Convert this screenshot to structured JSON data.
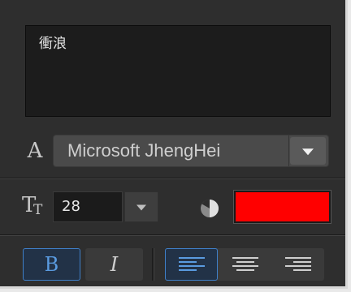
{
  "text_box": {
    "content": "衝浪"
  },
  "font": {
    "icon": "font-A-icon",
    "selected": "Microsoft JhengHei"
  },
  "size": {
    "icon": "font-size-icon",
    "value": "28"
  },
  "color": {
    "icon": "opacity-icon",
    "value": "#ff0000"
  },
  "formatting": {
    "bold_label": "B",
    "italic_label": "I",
    "bold_active": true,
    "italic_active": false
  },
  "alignment": {
    "options": [
      "left",
      "center",
      "right"
    ],
    "selected": "left"
  }
}
